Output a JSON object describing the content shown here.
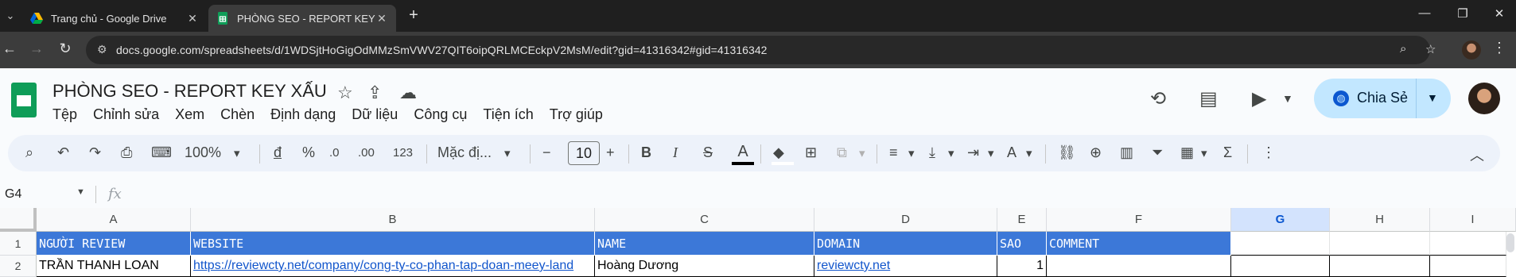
{
  "browser": {
    "tabs": [
      {
        "title": "Trang chủ - Google Drive",
        "active": false
      },
      {
        "title": "PHÒNG SEO - REPORT KEY XẤU",
        "active": true
      }
    ],
    "url": "docs.google.com/spreadsheets/d/1WDSjtHoGigOdMMzSmVWV27QIT6oipQRLMCEckpV2MsM/edit?gid=41316342#gid=41316342"
  },
  "doc": {
    "title": "PHÒNG SEO -  REPORT KEY XẤU",
    "menu": [
      "Tệp",
      "Chỉnh sửa",
      "Xem",
      "Chèn",
      "Định dạng",
      "Dữ liệu",
      "Công cụ",
      "Tiện ích",
      "Trợ giúp"
    ],
    "share_label": "Chia Sẻ"
  },
  "toolbar": {
    "zoom": "100%",
    "currency": "đ",
    "percent": "%",
    "dec_less": ".0",
    "dec_more": ".00",
    "num_format": "123",
    "font": "Mặc đị...",
    "font_size": "10"
  },
  "formula_bar": {
    "name_box": "G4",
    "fx": "fx"
  },
  "sheet": {
    "selected_column": "G",
    "columns": [
      "A",
      "B",
      "C",
      "D",
      "E",
      "F",
      "G",
      "H",
      "I"
    ],
    "rows": [
      {
        "num": "1",
        "cells": [
          "NGƯỜI REVIEW",
          "WEBSITE",
          "NAME",
          "DOMAIN",
          "SAO",
          "COMMENT",
          "",
          "",
          ""
        ]
      },
      {
        "num": "2",
        "cells": [
          "TRẦN THANH LOAN",
          "https://reviewcty.net/company/cong-ty-co-phan-tap-doan-meey-land",
          "Hoàng Dương",
          "reviewcty.net",
          "1",
          "",
          "",
          "",
          ""
        ]
      }
    ],
    "colors": {
      "header_fill": "#3c78d8",
      "link": "#1155cc"
    }
  }
}
